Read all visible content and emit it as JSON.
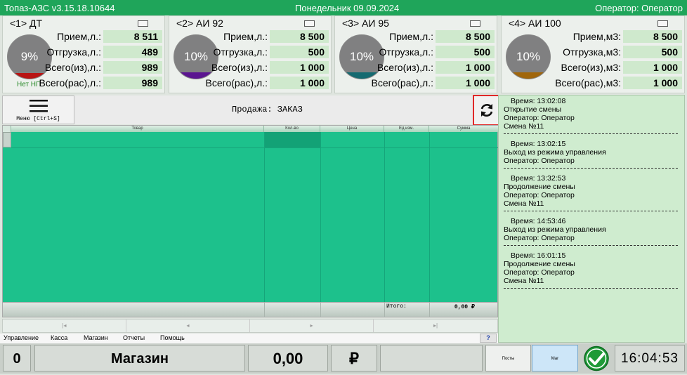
{
  "titlebar": {
    "app": "Топаз-АЗС v3.15.18.10644",
    "date": "Понедельник 09.09.2024",
    "operator": "Оператор: Оператор"
  },
  "pumps": [
    {
      "title": "<1> ДТ",
      "percent": "9%",
      "level_fraction": 0.09,
      "fill_color": "#b81414",
      "status": "Нет НП",
      "rows": [
        {
          "label": "Прием,л.:",
          "value": "8 511"
        },
        {
          "label": "Отгрузка,л.:",
          "value": "489"
        },
        {
          "label": "Всего(из),л.:",
          "value": "989"
        },
        {
          "label": "Всего(рас),л.:",
          "value": "989"
        }
      ]
    },
    {
      "title": "<2> АИ 92",
      "percent": "10%",
      "level_fraction": 0.1,
      "fill_color": "#5b1590",
      "rows": [
        {
          "label": "Прием,л.:",
          "value": "8 500"
        },
        {
          "label": "Отгрузка,л.:",
          "value": "500"
        },
        {
          "label": "Всего(из),л.:",
          "value": "1 000"
        },
        {
          "label": "Всего(рас),л.:",
          "value": "1 000"
        }
      ]
    },
    {
      "title": "<3> АИ 95",
      "percent": "10%",
      "level_fraction": 0.1,
      "fill_color": "#156a70",
      "rows": [
        {
          "label": "Прием,л.:",
          "value": "8 500"
        },
        {
          "label": "Отгрузка,л.:",
          "value": "500"
        },
        {
          "label": "Всего(из),л.:",
          "value": "1 000"
        },
        {
          "label": "Всего(рас),л.:",
          "value": "1 000"
        }
      ]
    },
    {
      "title": "<4> АИ 100",
      "percent": "10%",
      "level_fraction": 0.1,
      "fill_color": "#a0660c",
      "rows": [
        {
          "label": "Прием,м3:",
          "value": "8 500"
        },
        {
          "label": "Отгрузка,м3:",
          "value": "500"
        },
        {
          "label": "Всего(из),м3:",
          "value": "1 000"
        },
        {
          "label": "Всего(рас),м3:",
          "value": "1 000"
        }
      ]
    }
  ],
  "toolbar": {
    "menu_label": "Меню [Ctrl+S]",
    "menu_icon": "hamburger-icon",
    "sale_title": "Продажа: ЗАКАЗ",
    "refresh_icon": "refresh-icon"
  },
  "grid": {
    "columns": [
      "Товар",
      "Кол-во",
      "Цена",
      "Ед.изм.",
      "Сумма"
    ],
    "total_label": "Итого:",
    "total_value": "0,00 ₽"
  },
  "navbar": {
    "first": "|◂",
    "prev": "◂",
    "next": "▸",
    "last": "▸|"
  },
  "menu": [
    "Управление",
    "Касса",
    "Магазин",
    "Отчеты",
    "Помощь"
  ],
  "menu_help_glyph": "?",
  "log": [
    {
      "time": "Время: 13:02:08",
      "lines": [
        "Открытие смены",
        "Оператор: Оператор",
        "Смена №11"
      ]
    },
    {
      "time": "Время: 13:02:15",
      "lines": [
        "Выход из режима управления",
        "Оператор: Оператор"
      ]
    },
    {
      "time": "Время: 13:32:53",
      "lines": [
        "Продолжение смены",
        "Оператор: Оператор",
        "Смена №11"
      ]
    },
    {
      "time": "Время: 14:53:46",
      "lines": [
        "Выход из режима управления",
        "Оператор: Оператор"
      ]
    },
    {
      "time": "Время: 16:01:15",
      "lines": [
        "Продолжение смены",
        "Оператор: Оператор",
        "Смена №11"
      ]
    }
  ],
  "bottom": {
    "count": "0",
    "mode": "Магазин",
    "amount": "0,00",
    "currency": "₽",
    "tab_posts": "Посты",
    "tab_shop": "Маг",
    "confirm_icon": "check-icon",
    "clock": "16:04:53"
  },
  "colors": {
    "titlebar": "#1fa55a",
    "grid": "#1dc18c",
    "log_bg": "#cfeccf",
    "value_bg": "#cfe9cd"
  }
}
